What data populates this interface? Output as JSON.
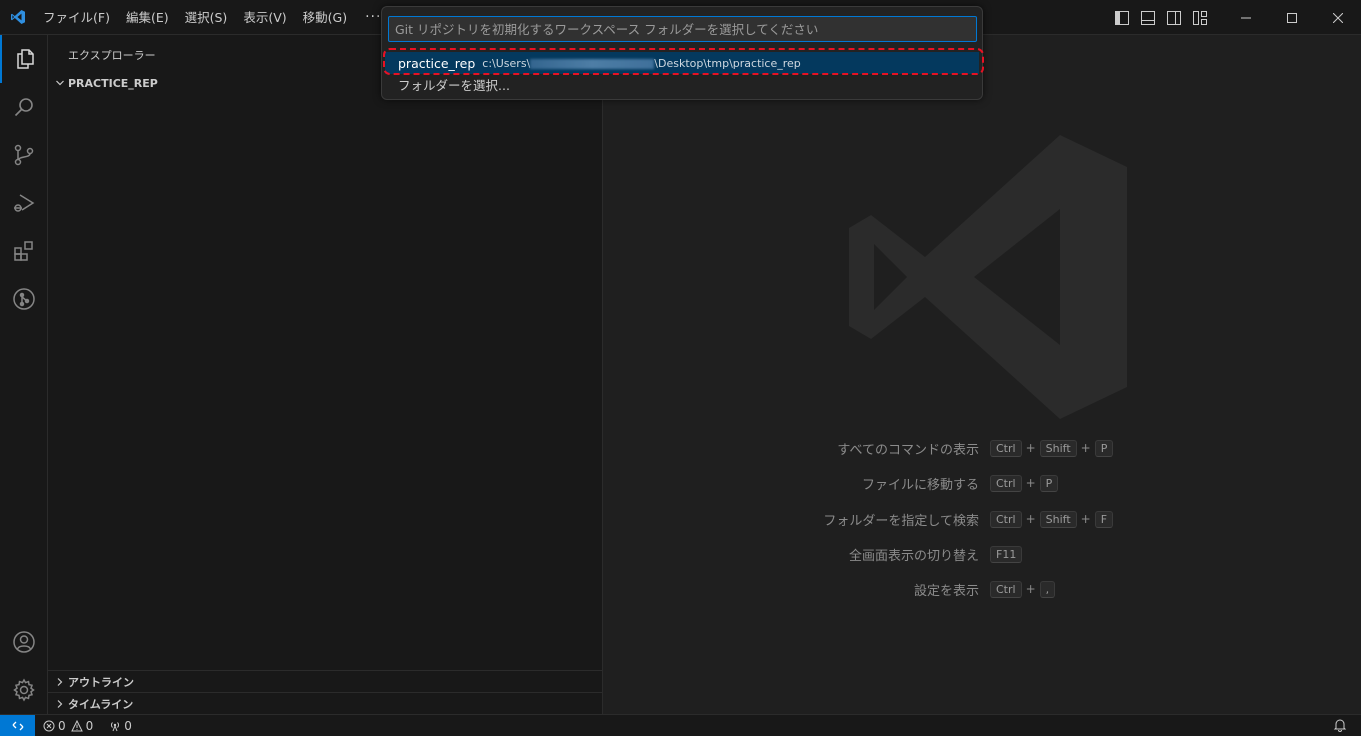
{
  "menu": {
    "items": [
      "ファイル(F)",
      "編集(E)",
      "選択(S)",
      "表示(V)",
      "移動(G)"
    ],
    "more": "···"
  },
  "sidebar": {
    "title": "エクスプローラー",
    "folder": "PRACTICE_REP",
    "sections": [
      "アウトライン",
      "タイムライン"
    ]
  },
  "quickpick": {
    "placeholder": "Git リポジトリを初期化するワークスペース フォルダーを選択してください",
    "items": [
      {
        "label": "practice_rep",
        "desc_prefix": "c:\\Users\\",
        "desc_suffix": "\\Desktop\\tmp\\practice_rep"
      },
      {
        "label": "フォルダーを選択..."
      }
    ]
  },
  "shortcuts": [
    {
      "label": "すべてのコマンドの表示",
      "keys": [
        "Ctrl",
        "Shift",
        "P"
      ]
    },
    {
      "label": "ファイルに移動する",
      "keys": [
        "Ctrl",
        "P"
      ]
    },
    {
      "label": "フォルダーを指定して検索",
      "keys": [
        "Ctrl",
        "Shift",
        "F"
      ]
    },
    {
      "label": "全画面表示の切り替え",
      "keys": [
        "F11"
      ]
    },
    {
      "label": "設定を表示",
      "keys": [
        "Ctrl",
        ","
      ]
    }
  ],
  "statusbar": {
    "errors": "0",
    "warnings": "0",
    "ports": "0"
  },
  "colors": {
    "accent": "#0078d4",
    "selection": "#04395e",
    "highlight": "#e81123"
  }
}
